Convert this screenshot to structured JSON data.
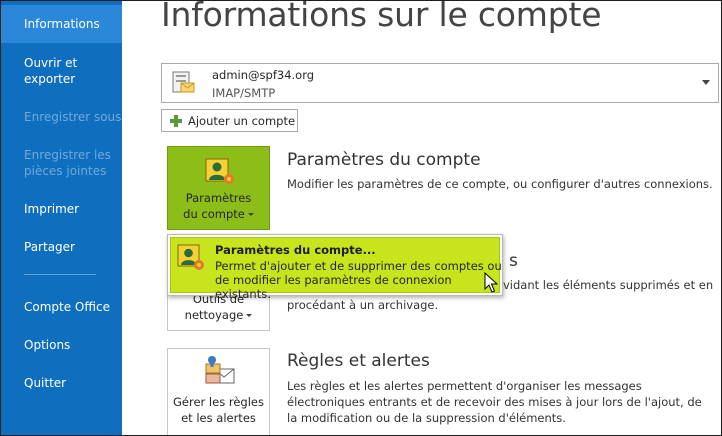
{
  "sidebar": {
    "items": [
      {
        "label": "Informations",
        "state": "active"
      },
      {
        "label": "Ouvrir et exporter",
        "state": "normal"
      },
      {
        "label": "Enregistrer sous",
        "state": "disabled"
      },
      {
        "label": "Enregistrer les pièces jointes",
        "state": "disabled"
      },
      {
        "label": "Imprimer",
        "state": "normal"
      },
      {
        "label": "Partager",
        "state": "normal"
      },
      {
        "label": "Compte Office",
        "state": "normal"
      },
      {
        "label": "Options",
        "state": "normal"
      },
      {
        "label": "Quitter",
        "state": "normal"
      }
    ]
  },
  "main": {
    "title": "Informations sur le compte",
    "account": {
      "email": "admin@spf34.org",
      "protocol": "IMAP/SMTP"
    },
    "add_account_label": "Ajouter un compte",
    "sections": {
      "account_settings": {
        "tile_line1": "Paramètres",
        "tile_line2": "du compte",
        "title": "Paramètres du compte",
        "description": "Modifier les paramètres de ce compte, ou configurer d'autres connexions."
      },
      "cleanup": {
        "tile_line1": "Outils de",
        "tile_line2": "nettoyage",
        "title_fragment": "s",
        "description_line1": "vidant les éléments supprimés et en",
        "description_line2": "procédant à un archivage."
      },
      "rules": {
        "tile_line1": "Gérer les règles",
        "tile_line2": "et les alertes",
        "title": "Règles et alertes",
        "description": "Les règles et les alertes permettent d'organiser les messages électroniques entrants et de recevoir des mises à jour lors de l'ajout, de la modification ou de la suppression d'éléments."
      }
    },
    "popup": {
      "title": "Paramètres du compte...",
      "description": "Permet d'ajouter et de supprimer des comptes ou de modifier les paramètres de connexion existants."
    }
  },
  "colors": {
    "sidebar_bg": "#106ebe",
    "sidebar_active": "#2b88d8",
    "tile_selected": "#8cbd18",
    "popup_highlight": "#c7e41d"
  }
}
